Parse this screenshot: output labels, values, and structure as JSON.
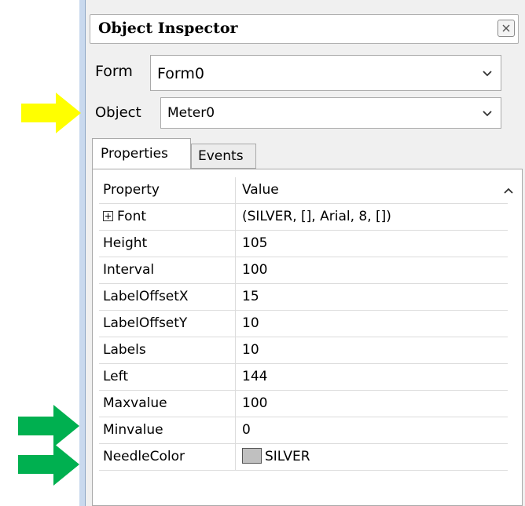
{
  "window": {
    "title": "Object Inspector"
  },
  "form_selector": {
    "label": "Form",
    "value": "Form0"
  },
  "object_selector": {
    "label": "Object",
    "value": "Meter0"
  },
  "tabs": [
    {
      "label": "Properties",
      "active": true
    },
    {
      "label": "Events",
      "active": false
    }
  ],
  "grid": {
    "headers": {
      "property": "Property",
      "value": "Value"
    },
    "rows": [
      {
        "property": "Font",
        "value": "(SILVER, [], Arial, 8, [])",
        "expandable": true
      },
      {
        "property": "Height",
        "value": "105"
      },
      {
        "property": "Interval",
        "value": "100"
      },
      {
        "property": "LabelOffsetX",
        "value": "15"
      },
      {
        "property": "LabelOffsetY",
        "value": "10"
      },
      {
        "property": "Labels",
        "value": "10"
      },
      {
        "property": "Left",
        "value": "144"
      },
      {
        "property": "Maxvalue",
        "value": "100"
      },
      {
        "property": "Minvalue",
        "value": "0"
      },
      {
        "property": "NeedleColor",
        "value": "SILVER",
        "swatch": "#c0c0c0"
      }
    ]
  },
  "annotations": {
    "yellow_arrow_color": "#ffff00",
    "green_arrow_color": "#00b050"
  }
}
